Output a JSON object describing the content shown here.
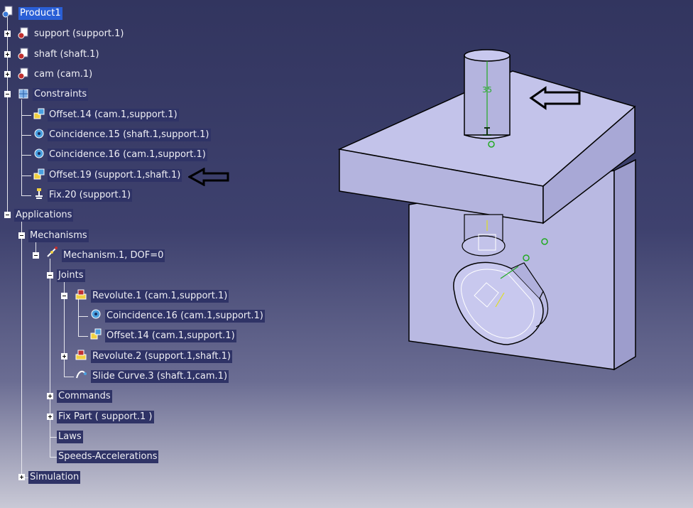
{
  "tree": {
    "root": "Product1",
    "parts": [
      {
        "label": "support (support.1)"
      },
      {
        "label": "shaft (shaft.1)"
      },
      {
        "label": "cam (cam.1)"
      }
    ],
    "constraints_label": "Constraints",
    "constraints": [
      {
        "label": "Offset.14 (cam.1,support.1)"
      },
      {
        "label": "Coincidence.15 (shaft.1,support.1)"
      },
      {
        "label": "Coincidence.16 (cam.1,support.1)"
      },
      {
        "label": "Offset.19 (support.1,shaft.1)"
      },
      {
        "label": "Fix.20 (support.1)"
      }
    ],
    "applications_label": "Applications",
    "mechanisms_label": "Mechanisms",
    "mechanism_label": "Mechanism.1, DOF=0",
    "joints_label": "Joints",
    "revolute1": "Revolute.1 (cam.1,support.1)",
    "rev1_children": [
      {
        "label": "Coincidence.16 (cam.1,support.1)"
      },
      {
        "label": "Offset.14 (cam.1,support.1)"
      }
    ],
    "revolute2": "Revolute.2 (support.1,shaft.1)",
    "slide_curve": "Slide Curve.3 (shaft.1,cam.1)",
    "commands_label": "Commands",
    "fixpart_label": "Fix Part ( support.1 )",
    "laws_label": "Laws",
    "speeds_label": "Speeds-Accelerations",
    "simulation_label": "Simulation"
  },
  "viewport": {
    "dimension_value": "35"
  },
  "colors": {
    "background_top": "#32355f",
    "background_bottom": "#c9c9d6",
    "label_bg": "#2f3366",
    "selected_bg": "#2a5fd6",
    "part_fill": "#b8b8e0",
    "constraint_green": "#22aa22"
  },
  "icons": {
    "product": "product-gear-icon",
    "part": "part-icon",
    "constraints": "constraints-icon",
    "offset": "offset-constraint-icon",
    "coincidence": "coincidence-constraint-icon",
    "fix": "fix-anchor-icon",
    "mechanism": "mechanism-icon",
    "revolute": "revolute-joint-icon",
    "slide": "slide-curve-icon",
    "annotation": "arrow-annotation-icon"
  }
}
